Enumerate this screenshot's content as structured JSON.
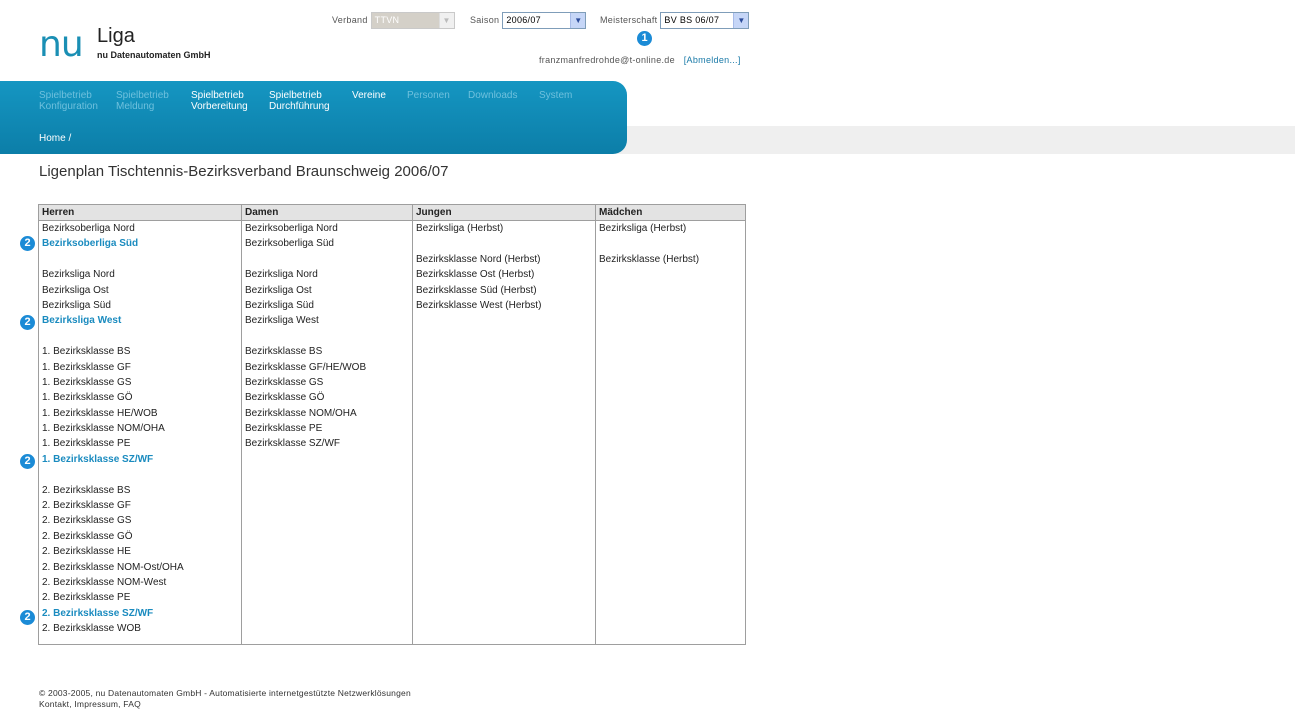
{
  "logo": {
    "nu": "nu",
    "liga": "Liga",
    "sub": "nu Datenautomaten GmbH"
  },
  "selectors": {
    "verband": {
      "label": "Verband",
      "value": "TTVN"
    },
    "saison": {
      "label": "Saison",
      "value": "2006/07"
    },
    "meisterschaft": {
      "label": "Meisterschaft",
      "value": "BV BS 06/07"
    }
  },
  "markers": {
    "one": "1",
    "two": "2"
  },
  "user": {
    "email": "franzmanfredrohde@t-online.de",
    "logout": "[Abmelden...]"
  },
  "nav": {
    "items": [
      {
        "l1": "Spielbetrieb",
        "l2": "Konfiguration"
      },
      {
        "l1": "Spielbetrieb",
        "l2": "Meldung"
      },
      {
        "l1": "Spielbetrieb",
        "l2": "Vorbereitung"
      },
      {
        "l1": "Spielbetrieb",
        "l2": "Durchführung"
      },
      {
        "l1": "Vereine",
        "l2": ""
      },
      {
        "l1": "Personen",
        "l2": ""
      },
      {
        "l1": "Downloads",
        "l2": ""
      },
      {
        "l1": "System",
        "l2": ""
      }
    ],
    "breadcrumb": "Home /"
  },
  "page": {
    "title": "Ligenplan Tischtennis-Bezirksverband Braunschweig 2006/07"
  },
  "table": {
    "headers": [
      "Herren",
      "Damen",
      "Jungen",
      "Mädchen"
    ],
    "herren": [
      "Bezirksoberliga Nord",
      "Bezirksoberliga Süd",
      "",
      "Bezirksliga Nord",
      "Bezirksliga Ost",
      "Bezirksliga Süd",
      "Bezirksliga West",
      "",
      "1. Bezirksklasse BS",
      "1. Bezirksklasse GF",
      "1. Bezirksklasse GS",
      "1. Bezirksklasse GÖ",
      "1. Bezirksklasse HE/WOB",
      "1. Bezirksklasse NOM/OHA",
      "1. Bezirksklasse PE",
      "1. Bezirksklasse SZ/WF",
      "",
      "2. Bezirksklasse BS",
      "2. Bezirksklasse GF",
      "2. Bezirksklasse GS",
      "2. Bezirksklasse GÖ",
      "2. Bezirksklasse HE",
      "2. Bezirksklasse NOM-Ost/OHA",
      "2. Bezirksklasse NOM-West",
      "2. Bezirksklasse PE",
      "2. Bezirksklasse SZ/WF",
      "2. Bezirksklasse WOB"
    ],
    "damen": [
      "Bezirksoberliga Nord",
      "Bezirksoberliga Süd",
      "",
      "Bezirksliga Nord",
      "Bezirksliga Ost",
      "Bezirksliga Süd",
      "Bezirksliga West",
      "",
      "Bezirksklasse BS",
      "Bezirksklasse GF/HE/WOB",
      "Bezirksklasse GS",
      "Bezirksklasse GÖ",
      "Bezirksklasse NOM/OHA",
      "Bezirksklasse PE",
      "Bezirksklasse SZ/WF"
    ],
    "jungen": [
      "Bezirksliga (Herbst)",
      "",
      "Bezirksklasse Nord (Herbst)",
      "Bezirksklasse Ost (Herbst)",
      "Bezirksklasse Süd (Herbst)",
      "Bezirksklasse West (Herbst)"
    ],
    "maedchen": [
      "Bezirksliga (Herbst)",
      "",
      "Bezirksklasse (Herbst)"
    ]
  },
  "highlight_color": "#1a8bbf",
  "footer": {
    "line1": "© 2003-2005, nu Datenautomaten GmbH - Automatisierte internetgestützte Netzwerklösungen",
    "line2": "Kontakt, Impressum, FAQ"
  }
}
